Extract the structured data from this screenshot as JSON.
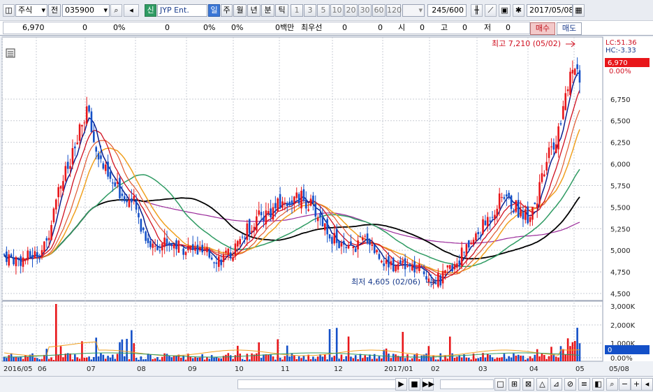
{
  "toolbar": {
    "market_label": "주식",
    "prefix_label": "전",
    "code_value": "035900",
    "credit_badge": "신",
    "stock_name": "JYP Ent.",
    "periods": [
      "일",
      "주",
      "월",
      "년",
      "분",
      "틱"
    ],
    "active_period": "일",
    "minutes": [
      "1",
      "3",
      "5",
      "10",
      "20",
      "30",
      "60",
      "120"
    ],
    "count_value": "245",
    "count_max": "/600",
    "date_value": "2017/05/08"
  },
  "quote": {
    "price": "6,970",
    "change": "0",
    "pct": "0%",
    "volume": "0",
    "vol_pct": "0%",
    "pct2": "0%",
    "unit_label": "0백만",
    "best_label": "최우선",
    "best_a": "0",
    "best_b": "0",
    "open_label": "시",
    "open": "0",
    "high_label": "고",
    "high": "0",
    "low_label": "저",
    "low": "0",
    "buy_label": "매수",
    "sell_label": "매도"
  },
  "chart_data": {
    "type": "candlestick",
    "yticks": [
      "6,750",
      "6,500",
      "6,250",
      "6,000",
      "5,750",
      "5,500",
      "5,250",
      "5,000",
      "4,750",
      "4,500"
    ],
    "ylim": [
      4500,
      7250
    ],
    "vol_yticks": [
      "3,000K",
      "2,000K",
      "1,000K",
      "0.00%"
    ],
    "xticks": [
      "2016/05",
      "06",
      "07",
      "08",
      "09",
      "10",
      "11",
      "12",
      "2017/01",
      "02",
      "03",
      "04",
      "05",
      "05/08"
    ],
    "high_label": "최고 7,210 (05/02)",
    "low_label": "최저 4,605 (02/06)",
    "lc_label": "LC:51.36",
    "hc_label": "HC:-3.33",
    "last_price": "6,970",
    "last_pct": "0.00%",
    "vol_last": "0",
    "colors": {
      "up": "#e8161a",
      "down": "#1450c8",
      "ma_short": "#0a1e8c",
      "ma_black": "#000000",
      "ma_green": "#2f9b63",
      "ma_orange": "#f0a020",
      "ma_purple": "#9a2a9a"
    }
  },
  "statusbar": {
    "icons": [
      "play",
      "stop",
      "fast-forward"
    ]
  }
}
